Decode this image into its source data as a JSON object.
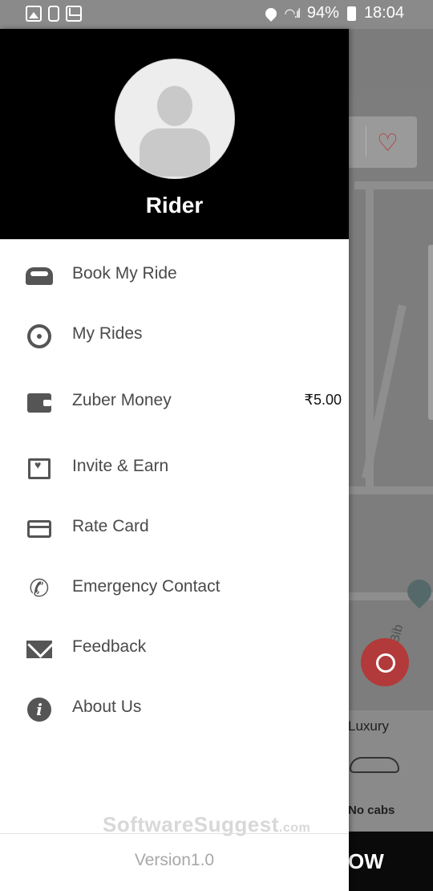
{
  "status_bar": {
    "battery": "94%",
    "time": "18:04"
  },
  "map": {
    "street_label": "ne Bib",
    "car_category": "Luxury",
    "car_status": "No cabs",
    "bottom_button_partial": "OW"
  },
  "drawer": {
    "user_name": "Rider",
    "menu": [
      {
        "label": "Book My Ride",
        "icon": "taxi-icon"
      },
      {
        "label": "My Rides",
        "icon": "steering-wheel-icon"
      },
      {
        "label": "Zuber Money",
        "icon": "wallet-icon",
        "value": "₹5.00"
      },
      {
        "label": "Invite & Earn",
        "icon": "gift-icon"
      },
      {
        "label": "Rate Card",
        "icon": "rate-card-icon"
      },
      {
        "label": "Emergency Contact",
        "icon": "phone-icon"
      },
      {
        "label": "Feedback",
        "icon": "mail-icon"
      },
      {
        "label": "About Us",
        "icon": "info-icon"
      }
    ],
    "watermark": "SoftwareSuggest",
    "watermark_suffix": ".com",
    "version": "Version1.0"
  },
  "colors": {
    "header_bg": "#000000",
    "menu_text": "#4a4a4a",
    "accent_red": "#b23a3a"
  }
}
